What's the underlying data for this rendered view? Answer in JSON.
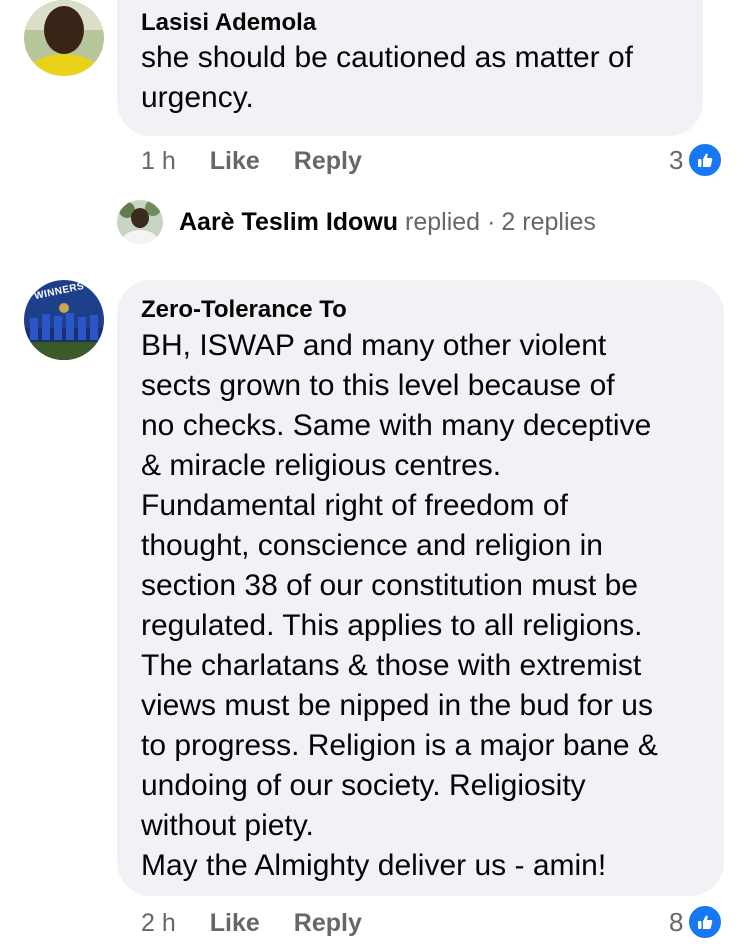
{
  "comments": [
    {
      "author": "Lasisi Ademola",
      "lines": [
        "she should be cautioned as matter of",
        "urgency."
      ],
      "time": "1 h",
      "like_label": "Like",
      "reply_label": "Reply",
      "reaction_count": "3",
      "reaction_icon": "thumbs-up-icon"
    },
    {
      "author": "Zero-Tolerance To",
      "lines": [
        "BH, ISWAP and many other violent",
        "sects grown to this level because of",
        "no checks. Same with many deceptive",
        "& miracle religious centres.",
        "Fundamental right of freedom of",
        "thought, conscience and religion in",
        "section 38 of our constitution must be",
        "regulated. This applies to all religions.",
        "The charlatans & those with extremist",
        "views must be nipped in the bud for us",
        "to progress. Religion is a major bane &",
        "undoing of our society. Religiosity",
        "without piety.",
        "May the Almighty deliver us - amin!"
      ],
      "avatar_text": "WINNERS",
      "time": "2 h",
      "like_label": "Like",
      "reply_label": "Reply",
      "reaction_count": "8",
      "reaction_icon": "thumbs-up-icon"
    }
  ],
  "reply_summary": {
    "name": "Aarè Teslim Idowu",
    "verb": "replied",
    "separator": "·",
    "count_text": "2 replies"
  },
  "colors": {
    "bubble": "#f0f2f5",
    "meta_text": "#65676b",
    "like_blue": "#1877f2"
  }
}
